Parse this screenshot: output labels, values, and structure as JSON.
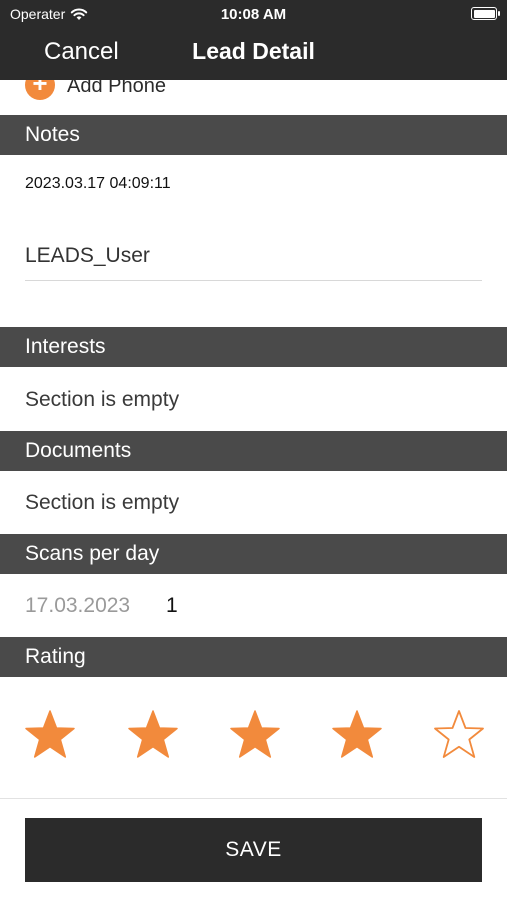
{
  "status_bar": {
    "carrier": "Operater",
    "time": "10:08 AM"
  },
  "nav": {
    "cancel_label": "Cancel",
    "title": "Lead Detail"
  },
  "add_phone": {
    "label": "Add Phone"
  },
  "notes": {
    "header": "Notes",
    "timestamp": "2023.03.17 04:09:11",
    "value": "LEADS_User"
  },
  "interests": {
    "header": "Interests",
    "empty_text": "Section is empty"
  },
  "documents": {
    "header": "Documents",
    "empty_text": "Section is empty"
  },
  "scans_per_day": {
    "header": "Scans per day",
    "rows": [
      {
        "date": "17.03.2023",
        "count": "1"
      }
    ]
  },
  "rating": {
    "header": "Rating",
    "value": 4,
    "max": 5,
    "filled_color": "#f28a3c",
    "empty_color": "#f28a3c"
  },
  "save_label": "SAVE",
  "colors": {
    "bar": "#2b2b2b",
    "section_header": "#4a4a4a",
    "accent": "#f28a3c"
  }
}
